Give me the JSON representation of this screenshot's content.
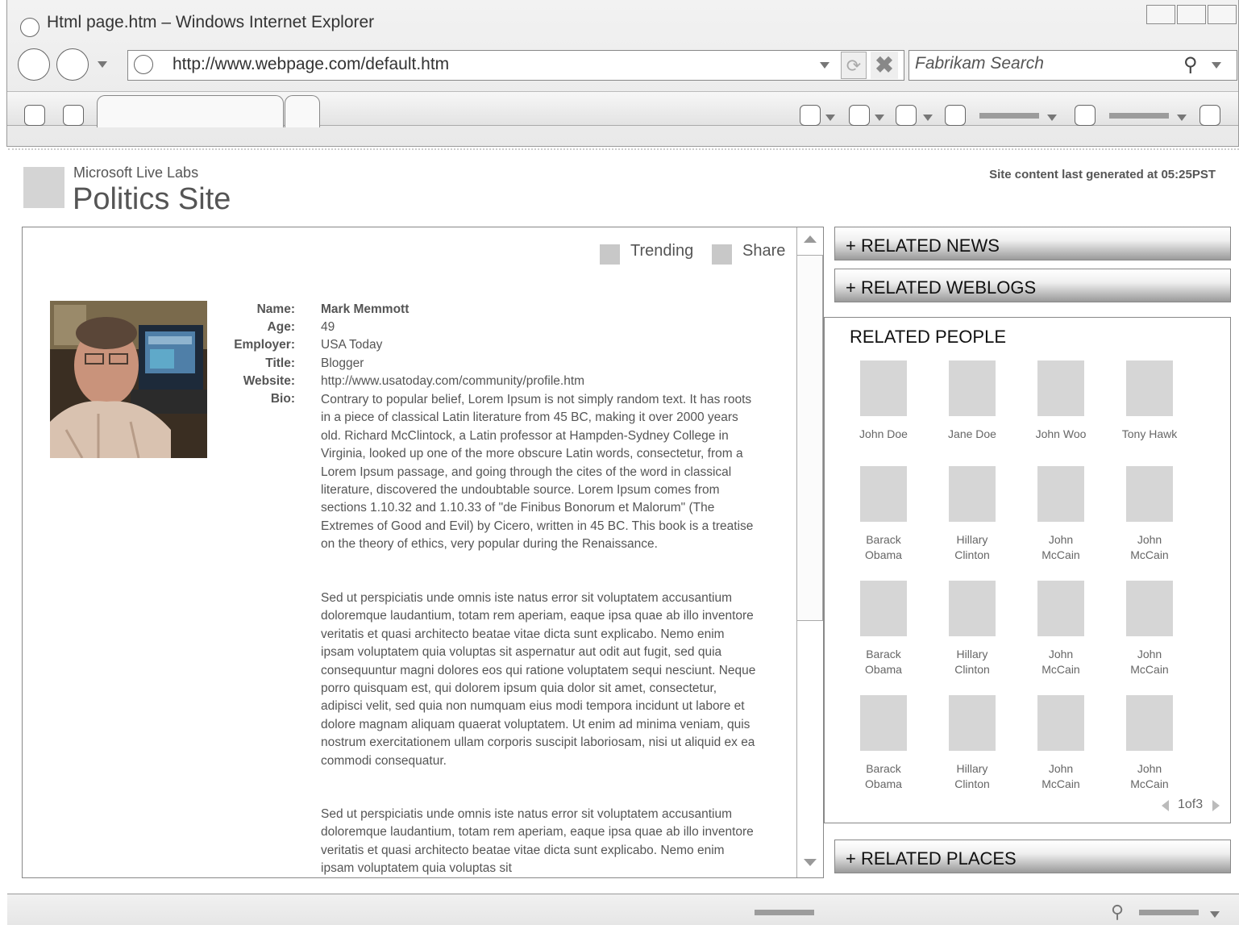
{
  "browser": {
    "window_title": "Html page.htm – Windows Internet Explorer",
    "url": "http://www.webpage.com/default.htm",
    "search_placeholder": "Fabrikam Search"
  },
  "site": {
    "brand_small": "Microsoft Live Labs",
    "brand_title": "Politics Site",
    "generated_text": "Site content last generated at 05:25PST"
  },
  "profile": {
    "actions": {
      "trending": "Trending",
      "share": "Share"
    },
    "fields": [
      {
        "label": "Name:",
        "value": "Mark Memmott"
      },
      {
        "label": "Age:",
        "value": "49"
      },
      {
        "label": "Employer:",
        "value": "USA Today"
      },
      {
        "label": "Title:",
        "value": "Blogger"
      },
      {
        "label": "Website:",
        "value": "http://www.usatoday.com/community/profile.htm"
      },
      {
        "label": "Bio:",
        "value": ""
      }
    ],
    "bio_paragraphs": [
      "Contrary to popular belief, Lorem Ipsum is not simply random text. It has roots in a piece of classical Latin literature from 45 BC, making it over 2000 years old. Richard McClintock, a Latin professor at Hampden-Sydney College in Virginia, looked up one of the more obscure Latin words, consectetur, from a Lorem Ipsum passage, and going through the cites of the word in classical literature, discovered the undoubtable source. Lorem Ipsum comes from sections 1.10.32 and 1.10.33 of \"de Finibus Bonorum et Malorum\" (The Extremes of Good and Evil) by Cicero, written in 45 BC. This book is a treatise on the theory of ethics, very popular during the Renaissance.",
      "Sed ut perspiciatis unde omnis iste natus error sit voluptatem accusantium doloremque laudantium, totam rem aperiam, eaque ipsa quae ab illo inventore veritatis et quasi architecto beatae vitae dicta sunt explicabo. Nemo enim ipsam voluptatem quia voluptas sit aspernatur aut odit aut fugit, sed quia consequuntur magni dolores eos qui ratione voluptatem sequi nesciunt. Neque porro quisquam est, qui dolorem ipsum quia dolor sit amet, consectetur, adipisci velit, sed quia non numquam eius modi tempora incidunt ut labore et dolore magnam aliquam quaerat voluptatem. Ut enim ad minima veniam, quis nostrum exercitationem ullam corporis suscipit laboriosam, nisi ut aliquid ex ea commodi consequatur.",
      "Sed ut perspiciatis unde omnis iste natus error sit voluptatem accusantium doloremque laudantium, totam rem aperiam, eaque ipsa quae ab illo inventore veritatis et quasi architecto beatae vitae dicta sunt explicabo. Nemo enim ipsam voluptatem quia voluptas sit"
    ]
  },
  "sidebar": {
    "related_news": "+ RELATED NEWS",
    "related_weblogs": "+ RELATED WEBLOGS",
    "related_people_title": "RELATED PEOPLE",
    "people": [
      [
        "John Doe"
      ],
      [
        "Jane Doe"
      ],
      [
        "John Woo"
      ],
      [
        "Tony Hawk"
      ],
      [
        "Barack",
        "Obama"
      ],
      [
        "Hillary",
        "Clinton"
      ],
      [
        "John",
        "McCain"
      ],
      [
        "John",
        "McCain"
      ],
      [
        "Barack",
        "Obama"
      ],
      [
        "Hillary",
        "Clinton"
      ],
      [
        "John",
        "McCain"
      ],
      [
        "John",
        "McCain"
      ],
      [
        "Barack",
        "Obama"
      ],
      [
        "Hillary",
        "Clinton"
      ],
      [
        "John",
        "McCain"
      ],
      [
        "John",
        "McCain"
      ]
    ],
    "pager": "1of3",
    "related_places": "+ RELATED PLACES"
  }
}
